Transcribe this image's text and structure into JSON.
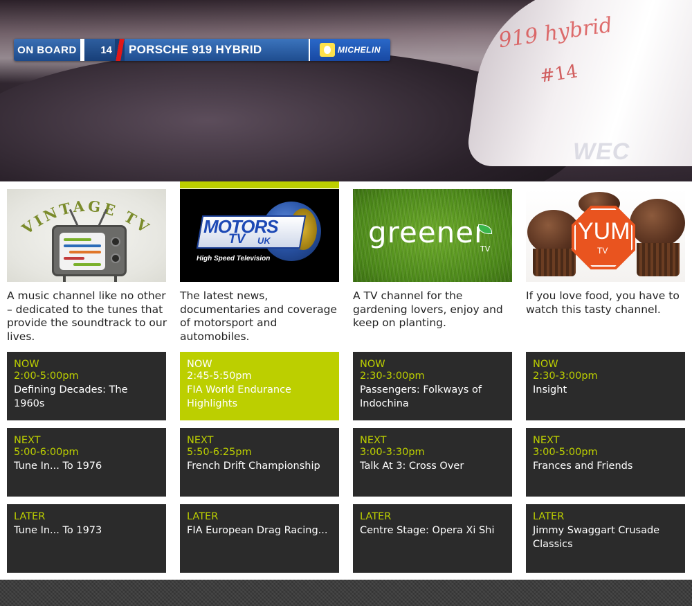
{
  "video": {
    "onboard_label": "ON BOARD",
    "car_number": "14",
    "car_name": "PORSCHE 919 HYBRID",
    "sponsor": "MICHELIN",
    "sidepod_script": "919 hybrid",
    "sidepod_number": "#14",
    "broadcaster_logo": "WEC"
  },
  "accent_color": "#bccf00",
  "channels": [
    {
      "name": "VINTAGE TV",
      "logo_text": "VINTAGE TV",
      "description": "A music channel like no other – dedicated to the tunes that provide the soundtrack to our lives.",
      "active": false,
      "now": {
        "tag": "NOW",
        "time": "2:00-5:00pm",
        "title": "Defining Decades: The 1960s"
      },
      "next": {
        "tag": "NEXT",
        "time": "5:00-6:00pm",
        "title": "Tune In... To 1976"
      },
      "later": {
        "tag": "LATER",
        "title": "Tune In... To 1973"
      }
    },
    {
      "name": "MOTORS TV UK",
      "logo_text": {
        "main": "MOTORS",
        "tv": "TV",
        "region": "UK",
        "tagline": "High Speed Television"
      },
      "description": "The latest news, documentaries and coverage of motorsport and automobiles.",
      "active": true,
      "now": {
        "tag": "NOW",
        "time": "2:45-5:50pm",
        "title": "FIA World Endurance Highlights"
      },
      "next": {
        "tag": "NEXT",
        "time": "5:50-6:25pm",
        "title": "French Drift Championship"
      },
      "later": {
        "tag": "LATER",
        "title": "FIA European Drag Racing..."
      }
    },
    {
      "name": "greener TV",
      "logo_text": {
        "main": "greener",
        "tv": "TV"
      },
      "description": "A TV channel for the gardening lovers, enjoy and keep on planting.",
      "active": false,
      "now": {
        "tag": "NOW",
        "time": "2:30-3:00pm",
        "title": "Passengers: Folkways of Indochina"
      },
      "next": {
        "tag": "NEXT",
        "time": "3:00-3:30pm",
        "title": "Talk At 3: Cross Over"
      },
      "later": {
        "tag": "LATER",
        "title": "Centre Stage: Opera Xi Shi"
      }
    },
    {
      "name": "YUM TV",
      "logo_text": {
        "main": "YUM",
        "tv": "TV"
      },
      "description": "If you love food, you have to watch this tasty channel.",
      "active": false,
      "now": {
        "tag": "NOW",
        "time": "2:30-3:00pm",
        "title": "Insight"
      },
      "next": {
        "tag": "NEXT",
        "time": "3:00-5:00pm",
        "title": "Frances and Friends"
      },
      "later": {
        "tag": "LATER",
        "title": "Jimmy Swaggart Crusade Classics"
      }
    }
  ]
}
